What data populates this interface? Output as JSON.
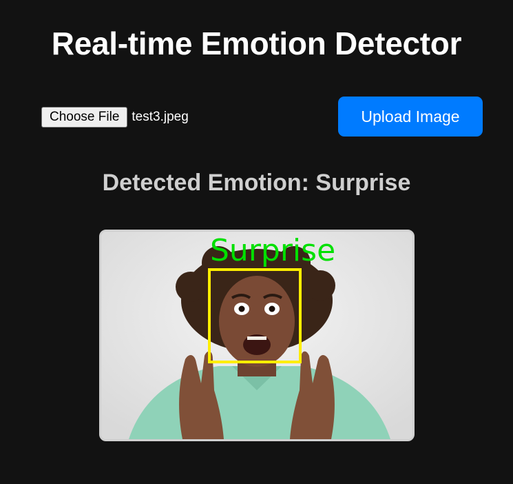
{
  "header": {
    "title": "Real-time Emotion Detector"
  },
  "upload": {
    "choose_file_label": "Choose File",
    "file_name": "test3.jpeg",
    "upload_button_label": "Upload Image"
  },
  "result": {
    "heading": "Detected Emotion: Surprise",
    "image_overlay_label": "Surprise"
  },
  "colors": {
    "background": "#121212",
    "accent_button": "#007bff",
    "overlay_label": "#00e000",
    "face_box": "#ffee00"
  }
}
